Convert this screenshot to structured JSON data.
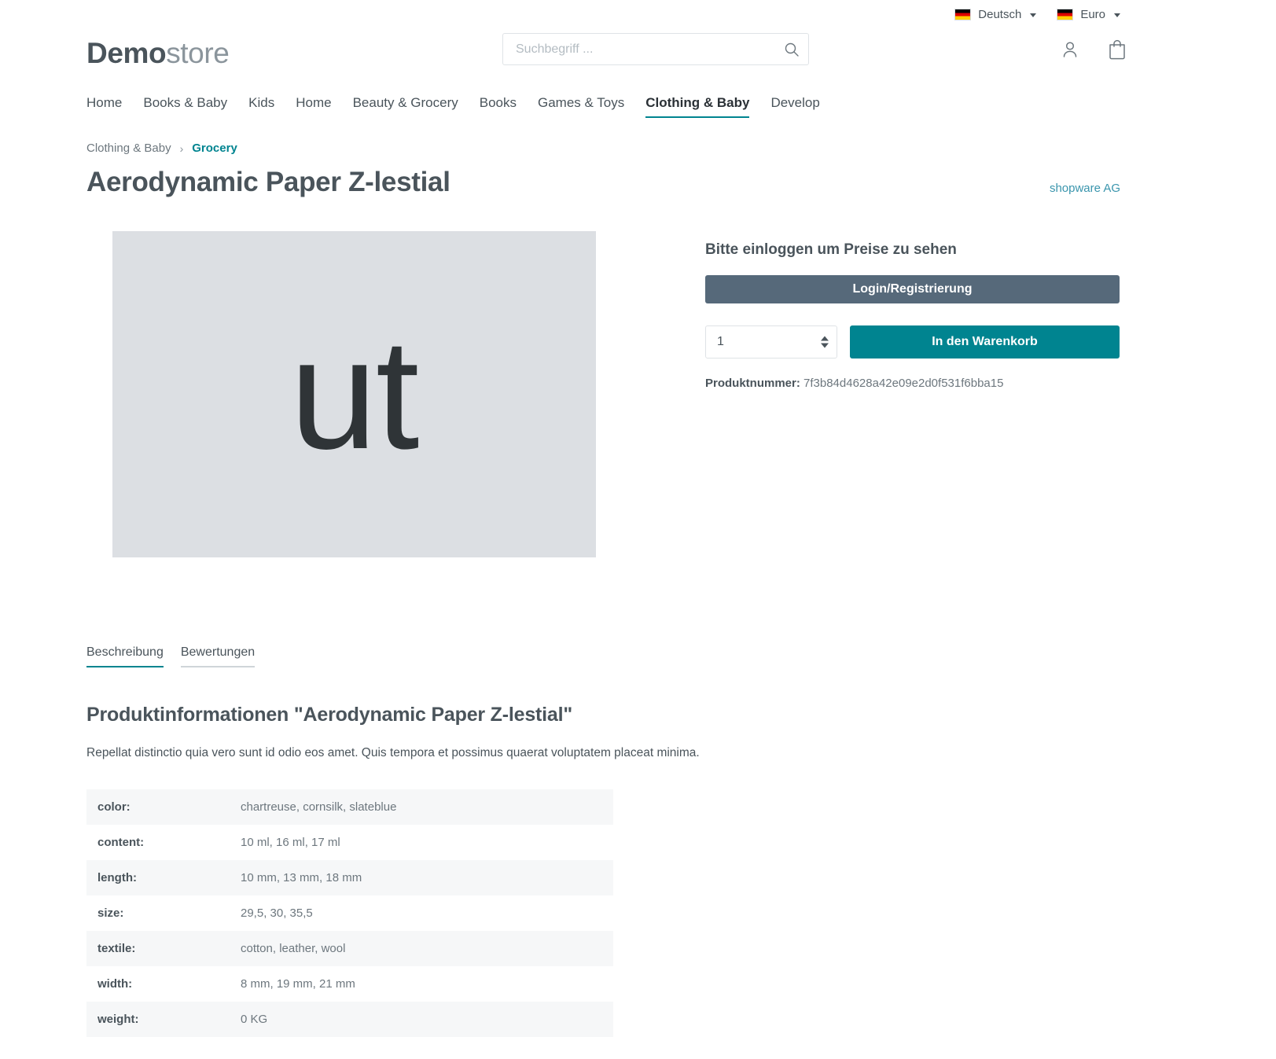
{
  "topbar": {
    "language": {
      "label": "Deutsch",
      "flag": "german-flag-icon"
    },
    "currency": {
      "label": "Euro",
      "flag": "german-flag-icon"
    }
  },
  "header": {
    "logo_bold": "Demo",
    "logo_light": "store",
    "search": {
      "placeholder": "Suchbegriff ...",
      "value": ""
    },
    "icons": {
      "account": "person-icon",
      "cart": "shopping-bag-icon"
    }
  },
  "nav": {
    "items": [
      {
        "label": "Home",
        "active": false
      },
      {
        "label": "Books & Baby",
        "active": false
      },
      {
        "label": "Kids",
        "active": false
      },
      {
        "label": "Home",
        "active": false
      },
      {
        "label": "Beauty & Grocery",
        "active": false
      },
      {
        "label": "Books",
        "active": false
      },
      {
        "label": "Games & Toys",
        "active": false
      },
      {
        "label": "Clothing & Baby",
        "active": true
      },
      {
        "label": "Develop",
        "active": false
      }
    ]
  },
  "breadcrumb": {
    "parent": "Clothing & Baby",
    "separator": "›",
    "current": "Grocery"
  },
  "product": {
    "title": "Aerodynamic Paper Z-lestial",
    "manufacturer": "shopware AG",
    "image_placeholder_text": "ut",
    "product_number_label": "Produktnummer:",
    "product_number": "7f3b84d4628a42e09e2d0f531f6bba15"
  },
  "buybox": {
    "heading": "Bitte einloggen um Preise zu sehen",
    "login_button": "Login/Registrierung",
    "quantity": "1",
    "add_to_cart_button": "In den Warenkorb"
  },
  "tabs": [
    {
      "label": "Beschreibung",
      "active": true
    },
    {
      "label": "Bewertungen",
      "active": false
    }
  ],
  "description": {
    "title": "Produktinformationen \"Aerodynamic Paper Z-lestial\"",
    "text": "Repellat distinctio quia vero sunt id odio eos amet. Quis tempora et possimus quaerat voluptatem placeat minima."
  },
  "properties": [
    {
      "key": "color:",
      "value": "chartreuse, cornsilk, slateblue"
    },
    {
      "key": "content:",
      "value": "10 ml, 16 ml, 17 ml"
    },
    {
      "key": "length:",
      "value": "10 mm, 13 mm, 18 mm"
    },
    {
      "key": "size:",
      "value": "29,5, 30, 35,5"
    },
    {
      "key": "textile:",
      "value": "cotton, leather, wool"
    },
    {
      "key": "width:",
      "value": "8 mm, 19 mm, 21 mm"
    },
    {
      "key": "weight:",
      "value": "0 KG"
    }
  ],
  "colors": {
    "accent": "#008490",
    "link": "#3a95ad",
    "login_button": "#56697a",
    "text": "#4a545b",
    "muted": "#6d777e"
  }
}
